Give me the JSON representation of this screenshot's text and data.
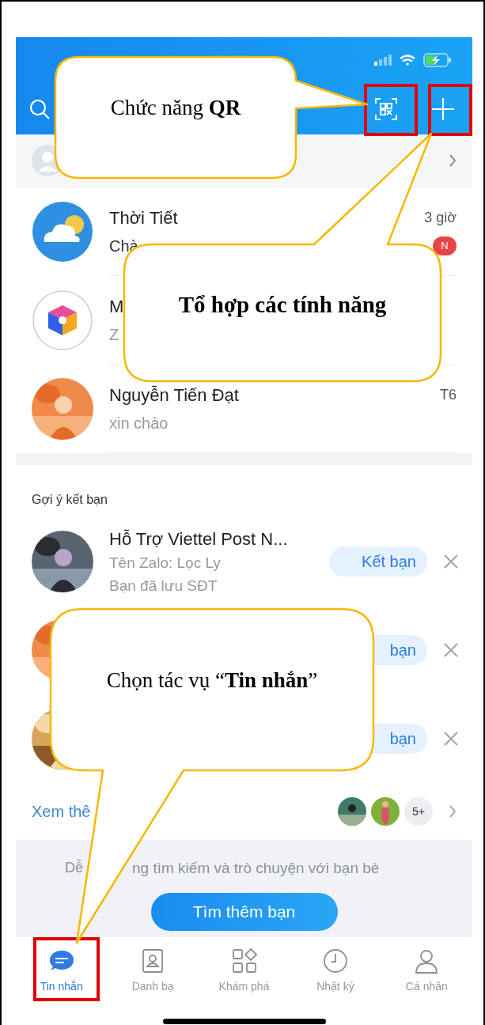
{
  "chats": [
    {
      "kind": "weather",
      "name": "Thời Tiết",
      "preview": "Chà",
      "time": "3 giờ",
      "badge": "N"
    },
    {
      "kind": "cube",
      "name": "M",
      "preview": "Z"
    },
    {
      "name": "Nguyễn Tiến Đạt",
      "preview": "xin chào",
      "time": "T6"
    }
  ],
  "suggestions": {
    "title": "Gợi ý kết bạn",
    "items": [
      {
        "name": "Hỗ Trợ Viettel Post N...",
        "lines": [
          "Tên Zalo: Lọc Ly",
          "Bạn đã lưu SĐT"
        ],
        "button": "Kết bạn"
      },
      {
        "button": "bạn"
      },
      {
        "button": "bạn"
      }
    ]
  },
  "see_more": {
    "label": "Xem thê",
    "count": "5+"
  },
  "find_friends": {
    "hint_start": "Dễ",
    "hint_rest": "ng tìm kiếm và trò chuyện với bạn bè",
    "button": "Tìm thêm bạn"
  },
  "tabs": [
    {
      "label": "Tin nhắn",
      "selected": true
    },
    {
      "label": "Danh bạ",
      "selected": false
    },
    {
      "label": "Khám phá",
      "selected": false
    },
    {
      "label": "Nhật ký",
      "selected": false
    },
    {
      "label": "Cá nhân",
      "selected": false
    }
  ],
  "callouts": [
    {
      "text": "Chức năng **QR**",
      "bold": false
    },
    {
      "text": "Tổ hợp các tính năng",
      "bold": true
    },
    {
      "text": "Chọn tác vụ “**Tin nhắn**”",
      "bold": false
    }
  ]
}
